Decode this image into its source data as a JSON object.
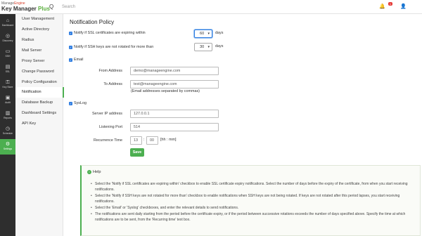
{
  "header": {
    "brand_top_prefix": "Manage",
    "brand_top_suffix": "Engine",
    "brand_main_prefix": "Key Manager ",
    "brand_main_suffix": "Plus",
    "search_placeholder": "Search",
    "search_icon_glyph": "Q",
    "notification_glyph": "🔔",
    "notification_count": "1",
    "user_glyph": "👤"
  },
  "rail": [
    {
      "glyph": "⌂",
      "label": "Dashboard",
      "active": false
    },
    {
      "glyph": "◎",
      "label": "Discovery",
      "active": false
    },
    {
      "glyph": "▭",
      "label": "SSH",
      "active": false
    },
    {
      "glyph": "▤",
      "label": "SSL",
      "active": false
    },
    {
      "glyph": "⚿",
      "label": "Key Store",
      "active": false
    },
    {
      "glyph": "▣",
      "label": "Audit",
      "active": false
    },
    {
      "glyph": "▥",
      "label": "Reports",
      "active": false
    },
    {
      "glyph": "◷",
      "label": "Schedule",
      "active": false
    },
    {
      "glyph": "⚙",
      "label": "Settings",
      "active": true
    }
  ],
  "subnav": [
    "User Management",
    "Active Directory",
    "Radius",
    "Mail Server",
    "Proxy Server",
    "Change Password",
    "Policy Configuration",
    "Notification",
    "Database Backup",
    "Dashboard Settings",
    "API Key"
  ],
  "main": {
    "title": "Notification Policy",
    "ssl_label": "Notify if SSL certificates are expiring within",
    "ssl_days": "60",
    "ssh_label": "Notify if SSH keys are not rotated for more than",
    "ssh_days": "30",
    "days_unit": "days",
    "check_glyph": "✓",
    "caret_glyph": "▾",
    "email_label": "Email",
    "from_label": "From Address",
    "from_value": "demo@manageengine.com",
    "to_label": "To Address",
    "to_value": "test@manageengine.com",
    "to_hint": "(Email addresses separated by commas)",
    "syslog_label": "SysLog",
    "server_label": "Server IP address",
    "server_value": "127.0.0.1",
    "port_label": "Listening Port",
    "port_value": "514",
    "recur_label": "Recurrence Time",
    "recur_hour": "13",
    "recur_sep": ":",
    "recur_min": "00",
    "recur_hint": "[hh : mm]",
    "save_label": "Save"
  },
  "help": {
    "icon_glyph": "i",
    "title": "Help",
    "items": [
      "Select the 'Notify if SSL certificates are expiring within' checkbox to enable SSL certificate expiry notifications. Select the number of days before the expiry of the certificate, from when you start receiving notifications.",
      "Select the 'Notify if SSH keys are not rotated for more than' checkbox to enable notifications when SSH keys are not being rotated. If keys are not rotated after this period lapses, you start receiving notifications.",
      "Select the 'Email' or 'Syslog' checkboxes, and enter the relevant details to send notifications.",
      "The notifications are sent daily starting from the period before the certificate expiry, or if the period between successive rotations exceeds the number of days specified above. Specify the time at which notifications are to be sent, from the 'Recurring time' text box."
    ]
  }
}
